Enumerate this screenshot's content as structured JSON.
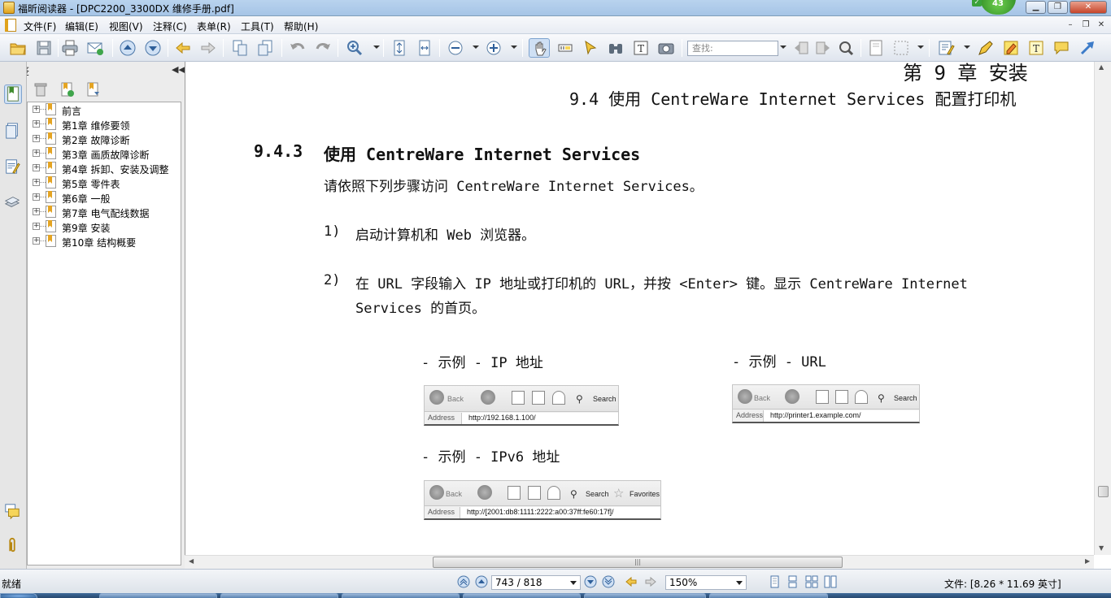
{
  "window": {
    "title": "福昕阅读器 - [DPC2200_3300DX 维修手册.pdf]",
    "badge": "43"
  },
  "menu": [
    "文件(F)",
    "编辑(E)",
    "视图(V)",
    "注释(C)",
    "表单(R)",
    "工具(T)",
    "帮助(H)"
  ],
  "toolbar": {
    "search_placeholder": "查找:"
  },
  "bookmarks": {
    "title": "书签",
    "items": [
      "前言",
      "第1章 维修要领",
      "第2章 故障诊断",
      "第3章 画质故障诊断",
      "第4章 拆卸、安装及调整",
      "第5章 零件表",
      "第6章 一般",
      "第7章 电气配线数据",
      "第9章 安装",
      "第10章 结构概要"
    ]
  },
  "page": {
    "header_chapter": "第 9 章   安装",
    "header_section": "9.4  使用 CentreWare Internet Services 配置打印机",
    "heading_number": "9.4.3",
    "heading_title": "使用 CentreWare Internet Services",
    "intro": "请依照下列步骤访问 CentreWare Internet Services。",
    "step1_num": "1)",
    "step1_text": "启动计算机和 Web 浏览器。",
    "step2_num": "2)",
    "step2_line1": "在 URL 字段输入 IP 地址或打印机的 URL，并按 <Enter> 键。显示 CentreWare Internet",
    "step2_line2": "Services 的首页。",
    "example_ip": {
      "caption": "- 示例  - IP 地址",
      "back": "Back",
      "search": "Search",
      "address_label": "Address",
      "url": "http://192.168.1.100/"
    },
    "example_url": {
      "caption": "- 示例 - URL",
      "back": "Back",
      "search": "Search",
      "address_label": "Address",
      "url": "http://printer1.example.com/"
    },
    "example_ipv6": {
      "caption": "- 示例  - IPv6 地址",
      "back": "Back",
      "search": "Search",
      "favorites": "Favorites",
      "address_label": "Address",
      "url": "http://[2001:db8:1111:2222:a00:37ff:fe60:17f]/"
    }
  },
  "status": {
    "ready": "就绪",
    "page": "743 / 818",
    "zoom": "150%",
    "file_info": "文件: [8.26 * 11.69 英寸]"
  }
}
